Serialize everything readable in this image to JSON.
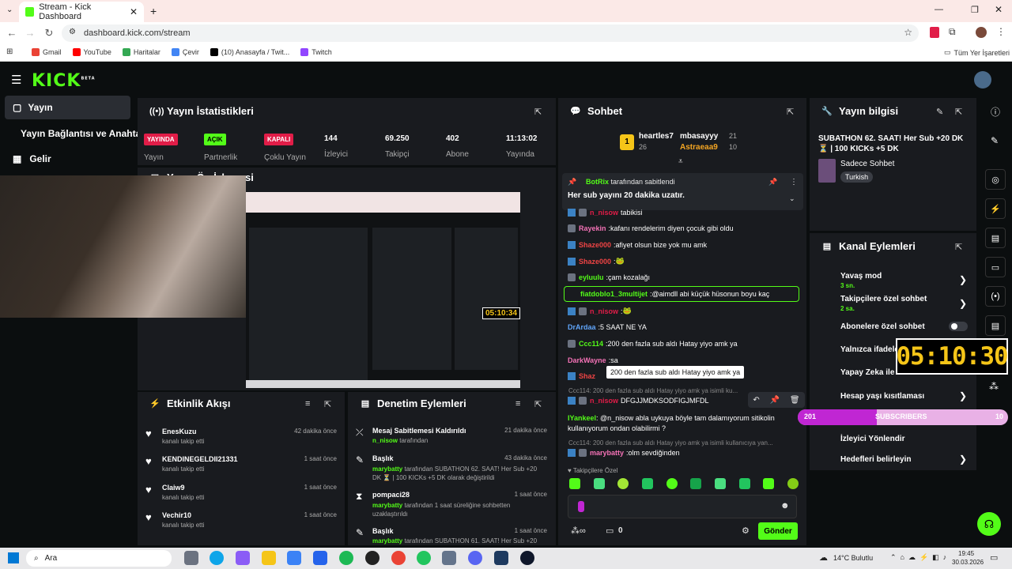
{
  "browser": {
    "tab_title": "Stream - Kick Dashboard",
    "url": "dashboard.kick.com/stream",
    "bookmarks": [
      "Gmail",
      "YouTube",
      "Haritalar",
      "Çevir",
      "(10) Anasayfa / Twit...",
      "Twitch"
    ],
    "all_bookmarks": "Tüm Yer İşaretleri"
  },
  "brand": {
    "logo": "KICK",
    "beta": "BETA",
    "accent": "#53fc18"
  },
  "sidebar": {
    "items": [
      {
        "label": "Yayın",
        "active": true
      },
      {
        "label": "Yayın Bağlantısı ve Anahtarı"
      },
      {
        "label": "Gelir"
      }
    ]
  },
  "stats": {
    "title": "Yayın İstatistikleri",
    "items": [
      {
        "badge": "YAYINDA",
        "label": "Yayın",
        "color": "#e11d48"
      },
      {
        "badge": "AÇIK",
        "label": "Partnerlik",
        "color": "#53fc18"
      },
      {
        "badge": "KAPALI",
        "label": "Çoklu Yayın",
        "color": "#e11d48"
      },
      {
        "value": "144",
        "label": "İzleyici"
      },
      {
        "value": "69.250",
        "label": "Takipçi"
      },
      {
        "value": "402",
        "label": "Abone"
      },
      {
        "value": "11:13:02",
        "label": "Yayında"
      }
    ]
  },
  "preview": {
    "title": "Yayın Ön İzlemesi",
    "timer": "05:10:34"
  },
  "events": {
    "title": "Etkinlik Akışı",
    "items": [
      {
        "name": "EnesKuzu",
        "action": "kanalı takip etti",
        "time": "42 dakika önce"
      },
      {
        "name": "KENDINEGELDII21331",
        "action": "kanalı takip etti",
        "time": "1 saat önce"
      },
      {
        "name": "Claiw9",
        "action": "kanalı takip etti",
        "time": "1 saat önce"
      },
      {
        "name": "Vechir10",
        "action": "kanalı takip etti",
        "time": "1 saat önce"
      }
    ]
  },
  "moderation": {
    "title": "Denetim Eylemleri",
    "items": [
      {
        "title": "Mesaj Sabitlemesi Kaldırıldı",
        "user": "n_nisow",
        "detail": "tarafından",
        "time": "21 dakika önce"
      },
      {
        "title": "Başlık",
        "user": "marybatty",
        "detail": "tarafından SUBATHON 62. SAAT! Her Sub +20 DK ⏳ | 100 KICKs +5 DK olarak değiştirildi",
        "time": "43 dakika önce"
      },
      {
        "title": "pompaci28",
        "user": "marybatty",
        "detail": "tarafından 1 saat süreliğine sohbetten uzaklaştırıldı",
        "time": "1 saat önce"
      },
      {
        "title": "Başlık",
        "user": "marybatty",
        "detail": "tarafından SUBATHON 61. SAAT! Her Sub +20",
        "time": "1 saat önce"
      }
    ]
  },
  "chat": {
    "title": "Sohbet",
    "top": [
      {
        "rank": "1",
        "name": "heartles7",
        "count": "26"
      },
      {
        "name": "mbasayyy",
        "count": "21"
      },
      {
        "name": "Astraeaa9",
        "count": "10"
      }
    ],
    "pinned_by": "BotRix",
    "pinned_suffix": "tarafından sabitlendi",
    "pinned_text": "Her sub yayını 20 dakika uzatır.",
    "messages": [
      {
        "user": "n_nisow",
        "text": "tabikisi",
        "color": "#e11d48"
      },
      {
        "user": "Rayekin",
        "text": "kafanı rendelerim diyen çocuk gibi oldu",
        "color": "#f472b6"
      },
      {
        "user": "Shaze000",
        "text": "afiyet olsun bize yok mu amk",
        "color": "#ef4444"
      },
      {
        "user": "Shaze000",
        "text": "🐸",
        "color": "#ef4444"
      },
      {
        "user": "eyluulu",
        "text": "çam kozalağı",
        "color": "#53fc18"
      },
      {
        "user": "fiatdoblo1_3multijet",
        "text": "@aimdll abi küçük hüsonun boyu kaç",
        "color": "#53fc18"
      },
      {
        "user": "n_nisow",
        "text": "🐸",
        "color": "#e11d48"
      },
      {
        "user": "DrArdaa",
        "text": "5 SAAT NE YA",
        "color": "#60a5fa"
      },
      {
        "user": "Ccc114",
        "text": "200 den fazla sub aldı Hatay yiyo amk ya",
        "color": "#53fc18"
      },
      {
        "user": "DarkWayne",
        "text": "sa",
        "color": "#f472b6"
      },
      {
        "user": "Shaz",
        "text": "",
        "color": "#ef4444"
      }
    ],
    "tooltip": "200 den fazla sub aldı Hatay yiyo amk ya",
    "reply1": "Ccc114: 200 den fazla sub aldı Hatay yiyo amk ya isimli ku...",
    "hover_msg_user": "n_nisow",
    "hover_msg_text": "DFGJJMDKSODFIGJMFDL",
    "iyankeel_user": "IYankeel",
    "iyankeel_text": "@n_nisow abla uykuya böyle tam dalamıyorum sitikolin kullanıyorum ondan olabilirmi ?",
    "reply2": "Ccc114: 200 den fazla sub aldı Hatay yiyo amk ya isimli kullanıcıya yan...",
    "last_user": "marybatty",
    "last_text": "olm sevdiğinden",
    "followers_only": "Takipçilere Özel",
    "points": "0",
    "send": "Gönder"
  },
  "info": {
    "title": "Yayın bilgisi",
    "stream_title": "SUBATHON 62. SAAT! Her Sub +20 DK ⏳ | 100 KICKs +5 DK",
    "category": "Sadece Sohbet",
    "language": "Turkish"
  },
  "actions": {
    "title": "Kanal Eylemleri",
    "items": [
      {
        "label": "Yavaş mod",
        "sub": "3 sn."
      },
      {
        "label": "Takipçilere özel sohbet",
        "sub": "2 sa."
      },
      {
        "label": "Abonelere özel sohbet"
      },
      {
        "label": "Yalnızca ifadelerle sohbet"
      },
      {
        "label": "Yapay Zeka ile Sohbet"
      },
      {
        "label": "Hesap yaşı kısıtlaması"
      },
      {
        "label": "İzleyici Yönlendir"
      },
      {
        "label": "Hedefleri belirleyin"
      }
    ]
  },
  "overlay": {
    "timer": "05:10:30",
    "sub_left": "201",
    "sub_label": "SUBSCRIBERS",
    "sub_right": "10"
  },
  "taskbar": {
    "search": "Ara",
    "weather": "14°C Bulutlu",
    "time": "19:45",
    "date": "30.03.2026"
  }
}
